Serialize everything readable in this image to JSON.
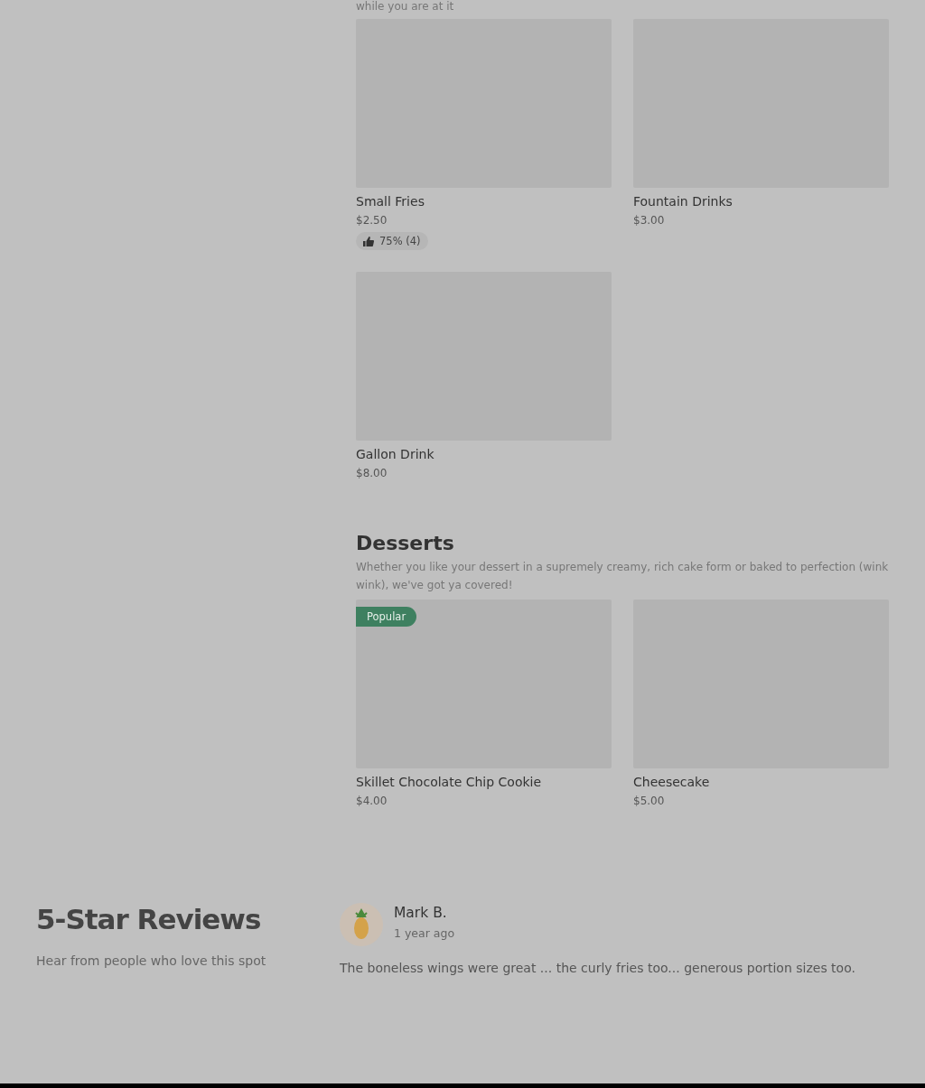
{
  "previous_section": {
    "description": "while you are at it"
  },
  "sections": [
    {
      "items": [
        {
          "name": "Small Fries",
          "price": "$2.50",
          "rating": "75% (4)"
        },
        {
          "name": "Fountain Drinks",
          "price": "$3.00"
        },
        {
          "name": "Gallon Drink",
          "price": "$8.00"
        }
      ]
    },
    {
      "title": "Desserts",
      "description": "Whether you like your dessert in a supremely creamy, rich cake form or baked to perfection (wink wink), we've got ya covered!",
      "items": [
        {
          "name": "Skillet Chocolate Chip Cookie",
          "price": "$4.00",
          "badge": "Popular"
        },
        {
          "name": "Cheesecake",
          "price": "$5.00"
        }
      ]
    }
  ],
  "reviews": {
    "title": "5-Star Reviews",
    "subtitle": "Hear from people who love this spot",
    "items": [
      {
        "author": "Mark B.",
        "time": "1 year ago",
        "text": "The boneless wings were great ... the curly fries too... generous portion sizes too."
      }
    ]
  }
}
